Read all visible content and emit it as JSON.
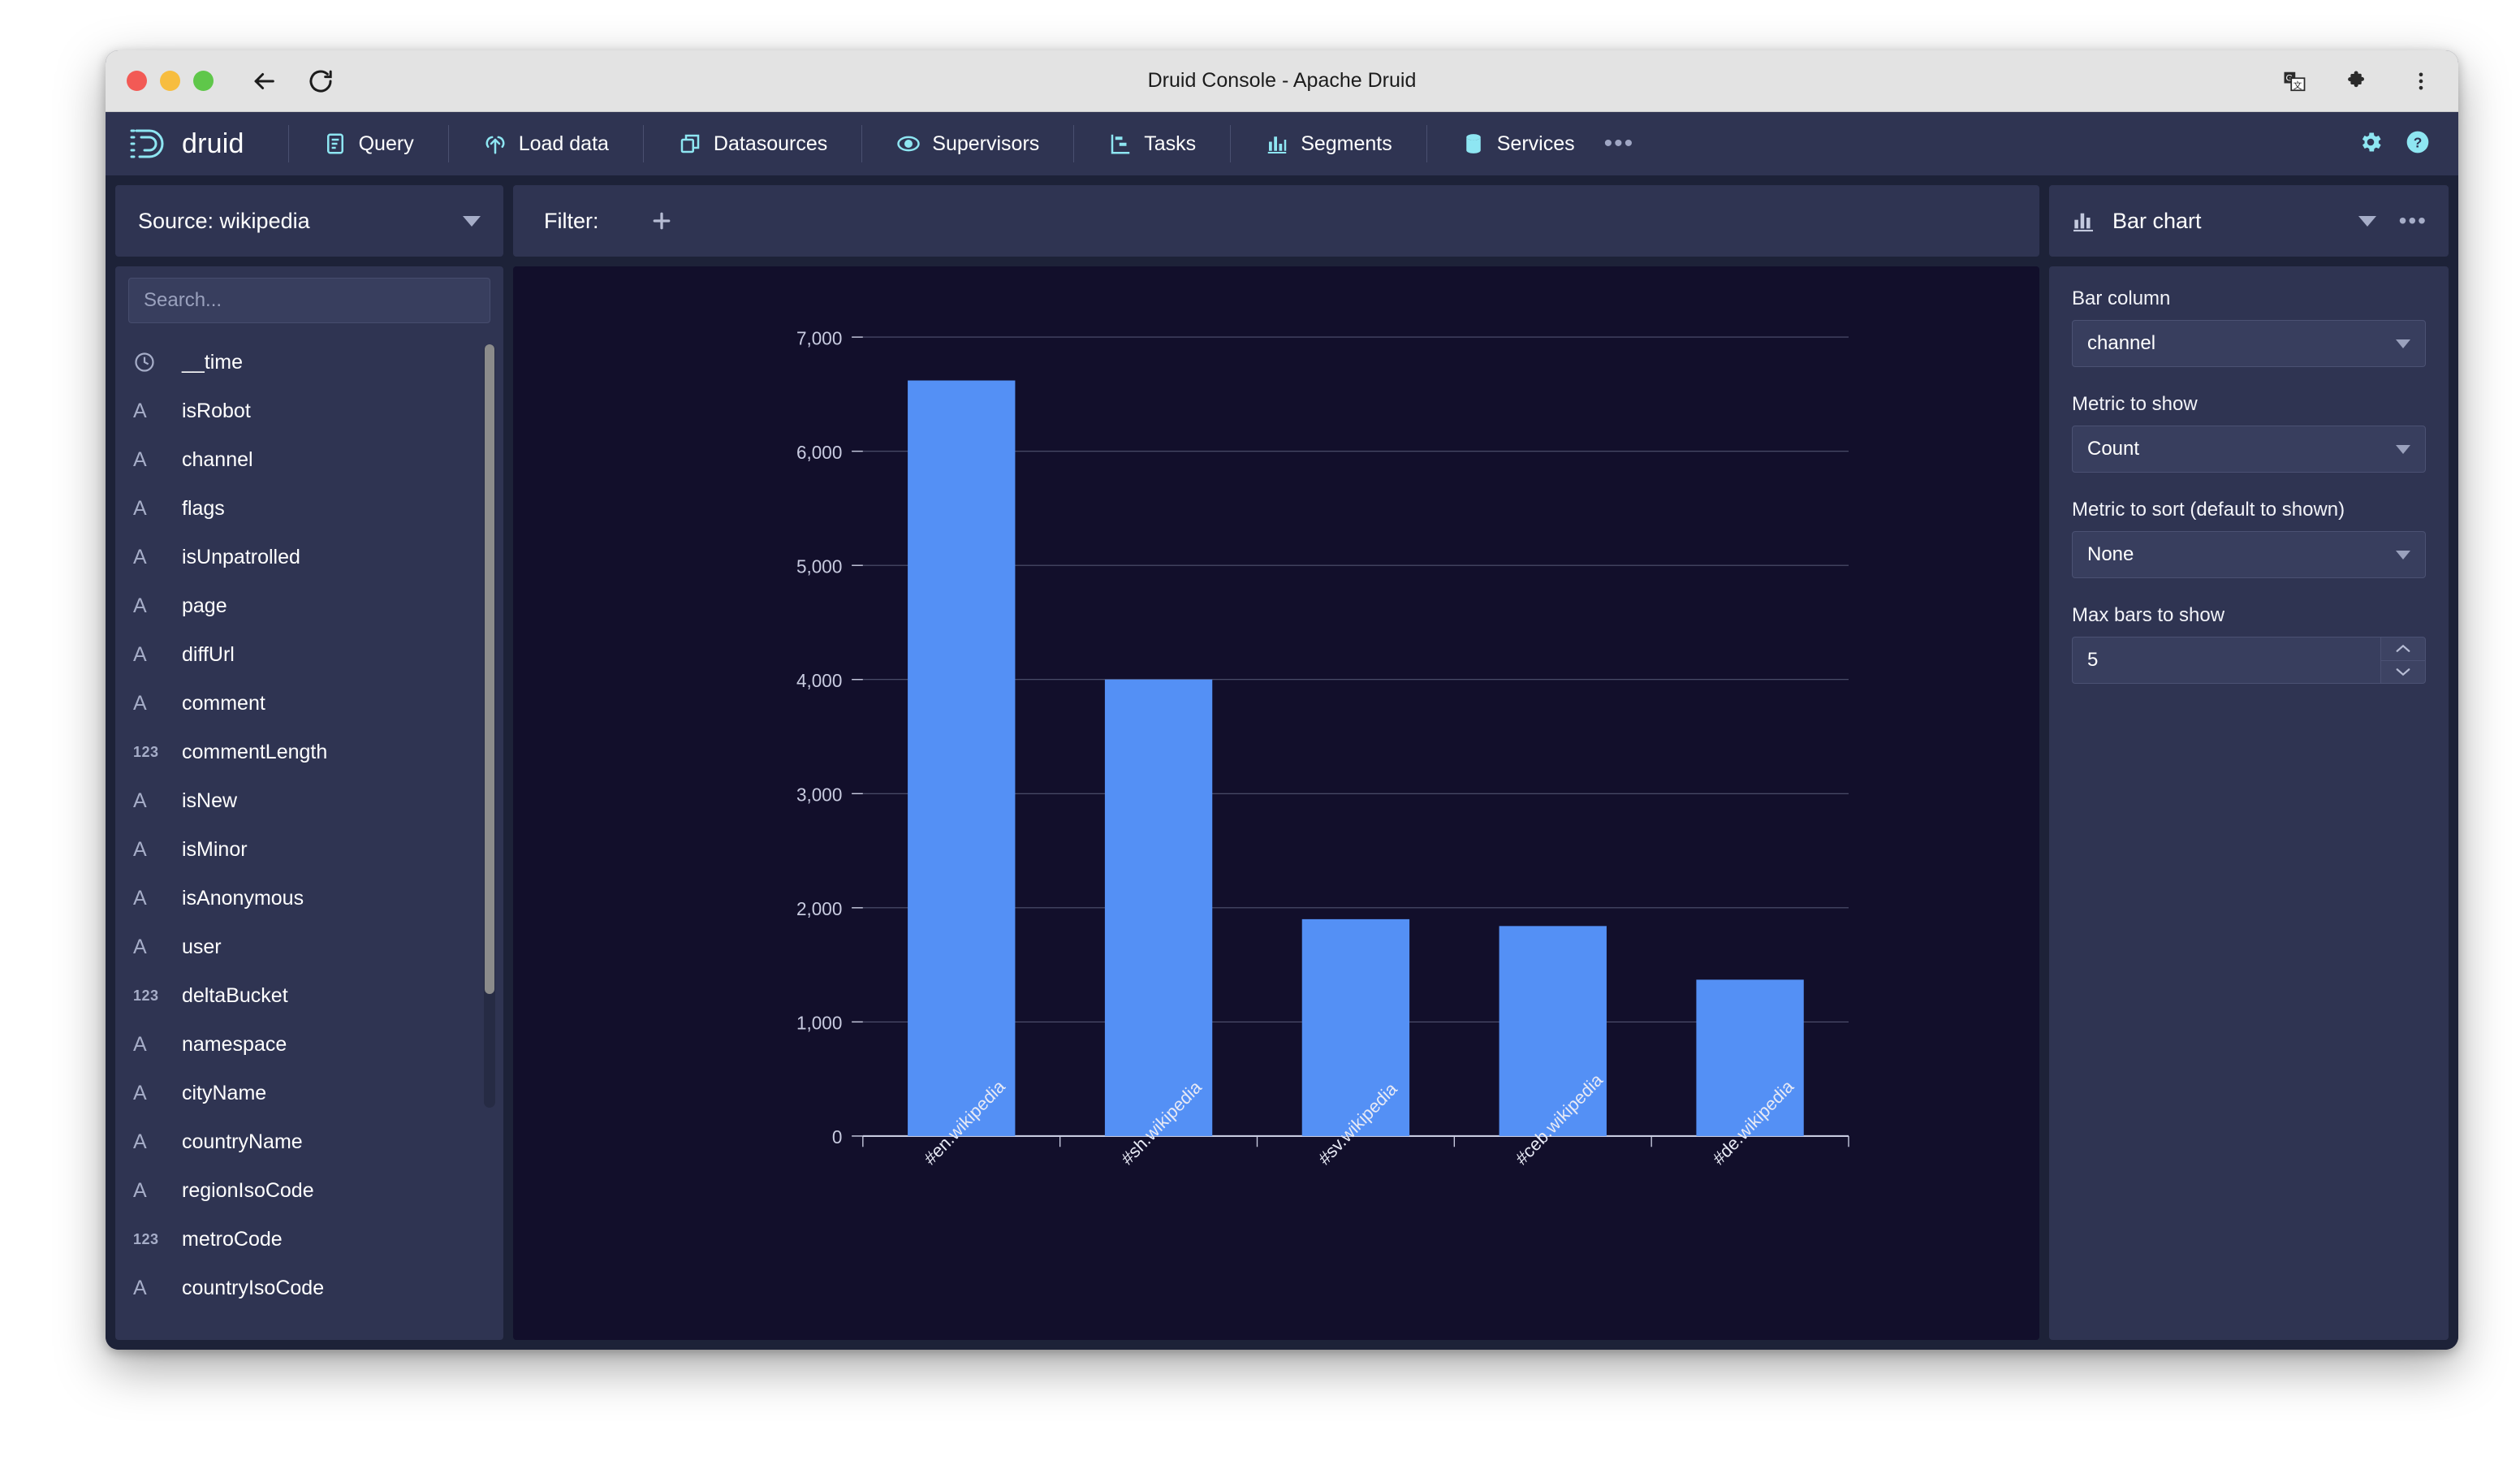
{
  "window": {
    "title": "Druid Console - Apache Druid",
    "back_icon": "back-arrow-icon",
    "reload_icon": "reload-icon",
    "translate_icon": "translate-icon",
    "extensions_icon": "extensions-puzzle-icon",
    "menu_icon": "browser-menu-icon"
  },
  "nav": {
    "brand": "druid",
    "items": [
      {
        "label": "Query",
        "icon": "query-document-icon"
      },
      {
        "label": "Load data",
        "icon": "load-data-upload-icon"
      },
      {
        "label": "Datasources",
        "icon": "datasources-stack-icon"
      },
      {
        "label": "Supervisors",
        "icon": "supervisors-eye-icon"
      },
      {
        "label": "Tasks",
        "icon": "tasks-gantt-icon"
      },
      {
        "label": "Segments",
        "icon": "segments-chart-icon"
      },
      {
        "label": "Services",
        "icon": "services-database-icon"
      }
    ],
    "overflow": "•••",
    "settings_icon": "gear-icon",
    "help_icon": "help-circle-icon"
  },
  "sidebar": {
    "source_label": "Source: wikipedia",
    "search_placeholder": "Search...",
    "search_value": "",
    "columns": [
      {
        "name": "__time",
        "type": "time"
      },
      {
        "name": "isRobot",
        "type": "string"
      },
      {
        "name": "channel",
        "type": "string"
      },
      {
        "name": "flags",
        "type": "string"
      },
      {
        "name": "isUnpatrolled",
        "type": "string"
      },
      {
        "name": "page",
        "type": "string"
      },
      {
        "name": "diffUrl",
        "type": "string"
      },
      {
        "name": "comment",
        "type": "string"
      },
      {
        "name": "commentLength",
        "type": "number"
      },
      {
        "name": "isNew",
        "type": "string"
      },
      {
        "name": "isMinor",
        "type": "string"
      },
      {
        "name": "isAnonymous",
        "type": "string"
      },
      {
        "name": "user",
        "type": "string"
      },
      {
        "name": "deltaBucket",
        "type": "number"
      },
      {
        "name": "namespace",
        "type": "string"
      },
      {
        "name": "cityName",
        "type": "string"
      },
      {
        "name": "countryName",
        "type": "string"
      },
      {
        "name": "regionIsoCode",
        "type": "string"
      },
      {
        "name": "metroCode",
        "type": "number"
      },
      {
        "name": "countryIsoCode",
        "type": "string"
      }
    ]
  },
  "filter": {
    "label": "Filter:",
    "add_icon": "plus-icon"
  },
  "viz": {
    "type_label": "Bar chart",
    "type_icon": "bar-chart-icon",
    "more_icon": "•••",
    "controls": [
      {
        "label": "Bar column",
        "value": "channel",
        "kind": "select"
      },
      {
        "label": "Metric to show",
        "value": "Count",
        "kind": "select"
      },
      {
        "label": "Metric to sort (default to shown)",
        "value": "None",
        "kind": "select"
      },
      {
        "label": "Max bars to show",
        "value": "5",
        "kind": "number"
      }
    ]
  },
  "chart_data": {
    "type": "bar",
    "title": "",
    "xlabel": "",
    "ylabel": "",
    "categories": [
      "#en.wikipedia",
      "#sh.wikipedia",
      "#sv.wikipedia",
      "#ceb.wikipedia",
      "#de.wikipedia"
    ],
    "values": [
      6620,
      4000,
      1900,
      1840,
      1370
    ],
    "ylim": [
      0,
      7000
    ],
    "yticks": [
      0,
      1000,
      2000,
      3000,
      4000,
      5000,
      6000,
      7000
    ],
    "ytick_labels": [
      "0",
      "1,000",
      "2,000",
      "3,000",
      "4,000",
      "5,000",
      "6,000",
      "7,000"
    ],
    "grid": true,
    "legend": false,
    "bar_color": "#5490f5",
    "plot_bg": "#120f2b",
    "axis_color": "#c8cbe0",
    "grid_color": "#5b5e7c",
    "label_rotation": -45
  }
}
